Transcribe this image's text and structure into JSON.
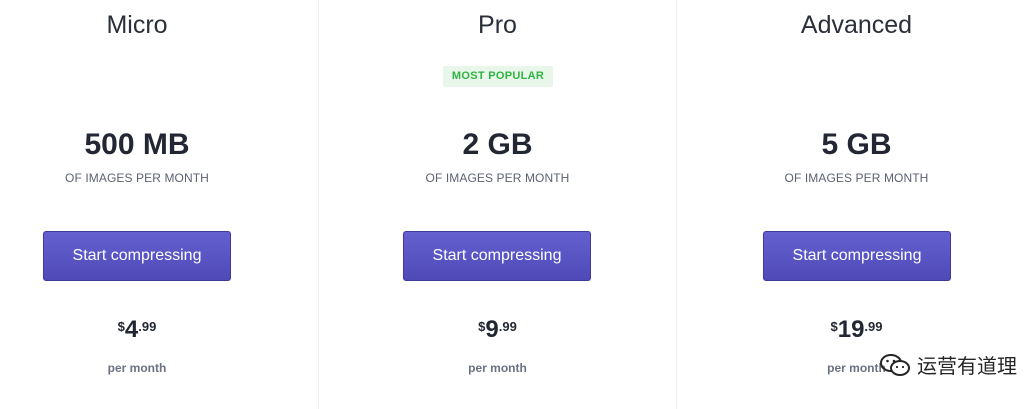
{
  "plans": [
    {
      "name": "Micro",
      "badge": "",
      "storage": "500 MB",
      "storage_sub": "OF IMAGES PER MONTH",
      "cta_label": "Start compressing",
      "price_currency": "$",
      "price_whole": "4",
      "price_cents": ".99",
      "price_period": "per month"
    },
    {
      "name": "Pro",
      "badge": "MOST POPULAR",
      "storage": "2 GB",
      "storage_sub": "OF IMAGES PER MONTH",
      "cta_label": "Start compressing",
      "price_currency": "$",
      "price_whole": "9",
      "price_cents": ".99",
      "price_period": "per month"
    },
    {
      "name": "Advanced",
      "badge": "",
      "storage": "5 GB",
      "storage_sub": "OF IMAGES PER MONTH",
      "cta_label": "Start compressing",
      "price_currency": "$",
      "price_whole": "19",
      "price_cents": ".99",
      "price_period": "per month"
    }
  ],
  "watermark": {
    "text": "运营有道理",
    "icon": "wechat-icon"
  },
  "colors": {
    "accent": "#5652c4",
    "badge_bg": "#e9f6ea",
    "badge_text": "#2fb344",
    "text": "#222733",
    "muted": "#5b6271"
  }
}
